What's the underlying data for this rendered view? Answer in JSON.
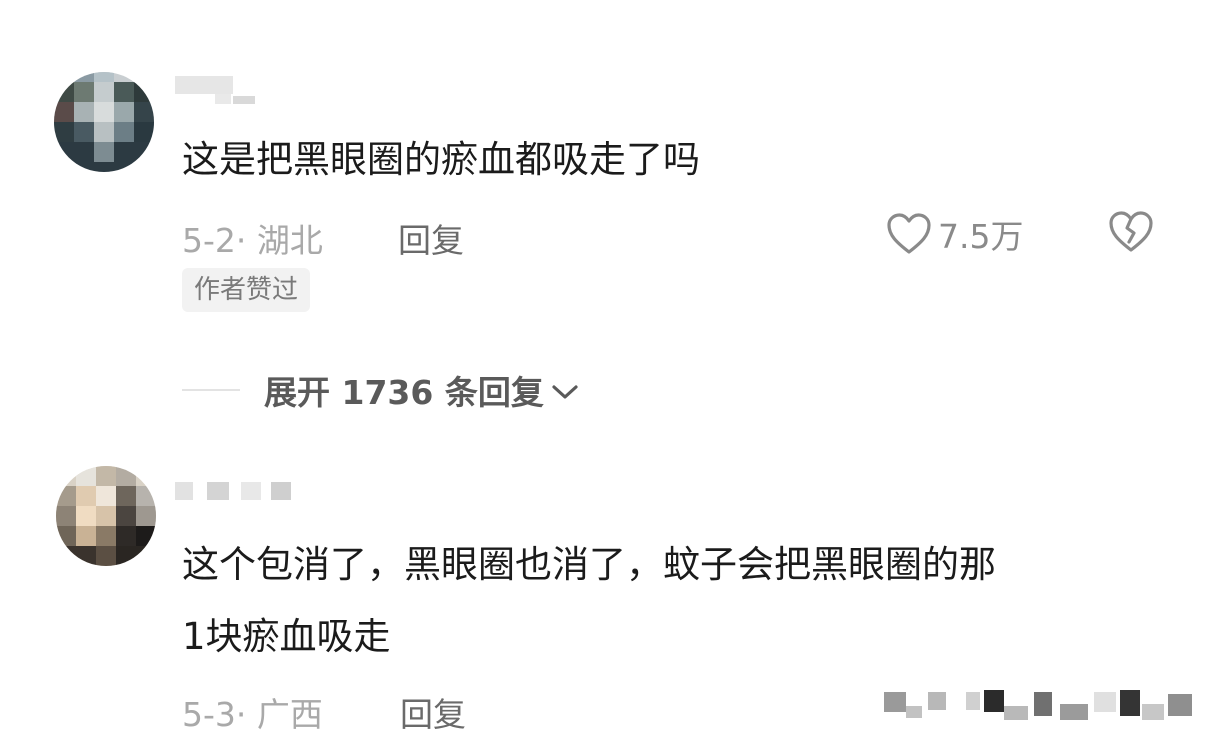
{
  "comments": [
    {
      "text": "这是把黑眼圈的瘀血都吸走了吗",
      "date_location": "5-2· 湖北",
      "reply_label": "回复",
      "likes": "7.5万",
      "badge": "作者赞过",
      "expand_label": "展开 1736 条回复"
    },
    {
      "text_line1": "这个包消了，黑眼圈也消了，蚊子会把黑眼圈的那",
      "text_line2": "1块瘀血吸走",
      "date_location": "5-3· 广西",
      "reply_label": "回复"
    }
  ],
  "icons": {
    "like": "heart-outline-icon",
    "dislike": "broken-heart-icon",
    "expand": "chevron-down-icon"
  },
  "colors": {
    "text_primary": "#1b1b1b",
    "text_meta": "#a9a9a9",
    "icon": "#8a8a8a"
  }
}
